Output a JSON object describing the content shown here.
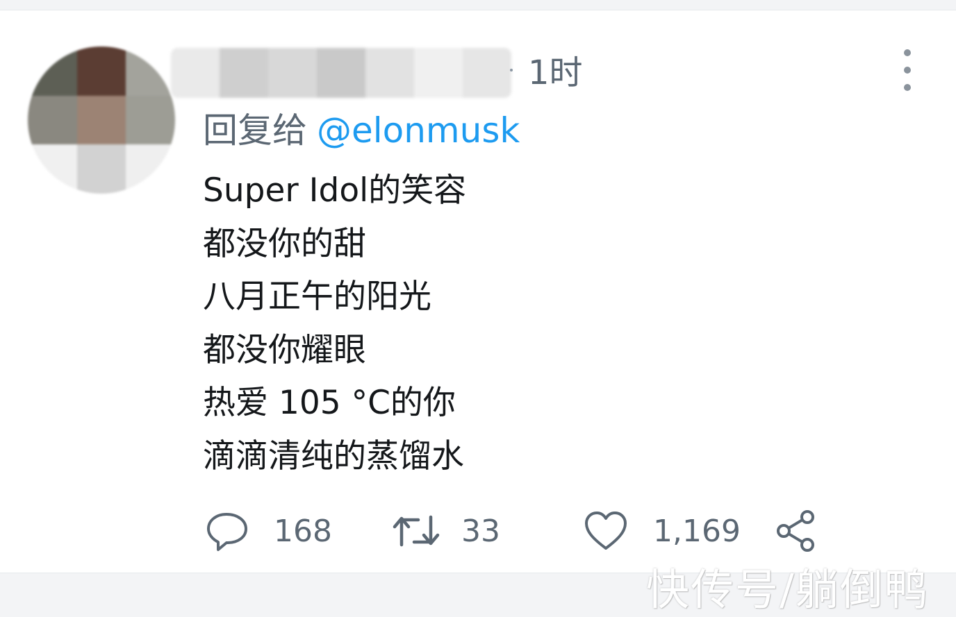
{
  "tweet": {
    "time": "1时",
    "reply_prefix": "回复给",
    "reply_mention": "@elonmusk",
    "lines": [
      "Super Idol的笑容",
      "都没你的甜",
      "八月正午的阳光",
      "都没你耀眼",
      "热爱 105 °C的你",
      "滴滴清纯的蒸馏水"
    ]
  },
  "actions": {
    "reply_count": "168",
    "retweet_count": "33",
    "like_count": "1,169"
  },
  "icons": [
    "more-icon",
    "reply-icon",
    "retweet-icon",
    "like-icon",
    "share-icon"
  ],
  "watermark": "快传号/躺倒鸭",
  "colors": {
    "mention": "#1d9bf0",
    "secondary_text": "#5b6773",
    "primary_text": "#14171a"
  }
}
